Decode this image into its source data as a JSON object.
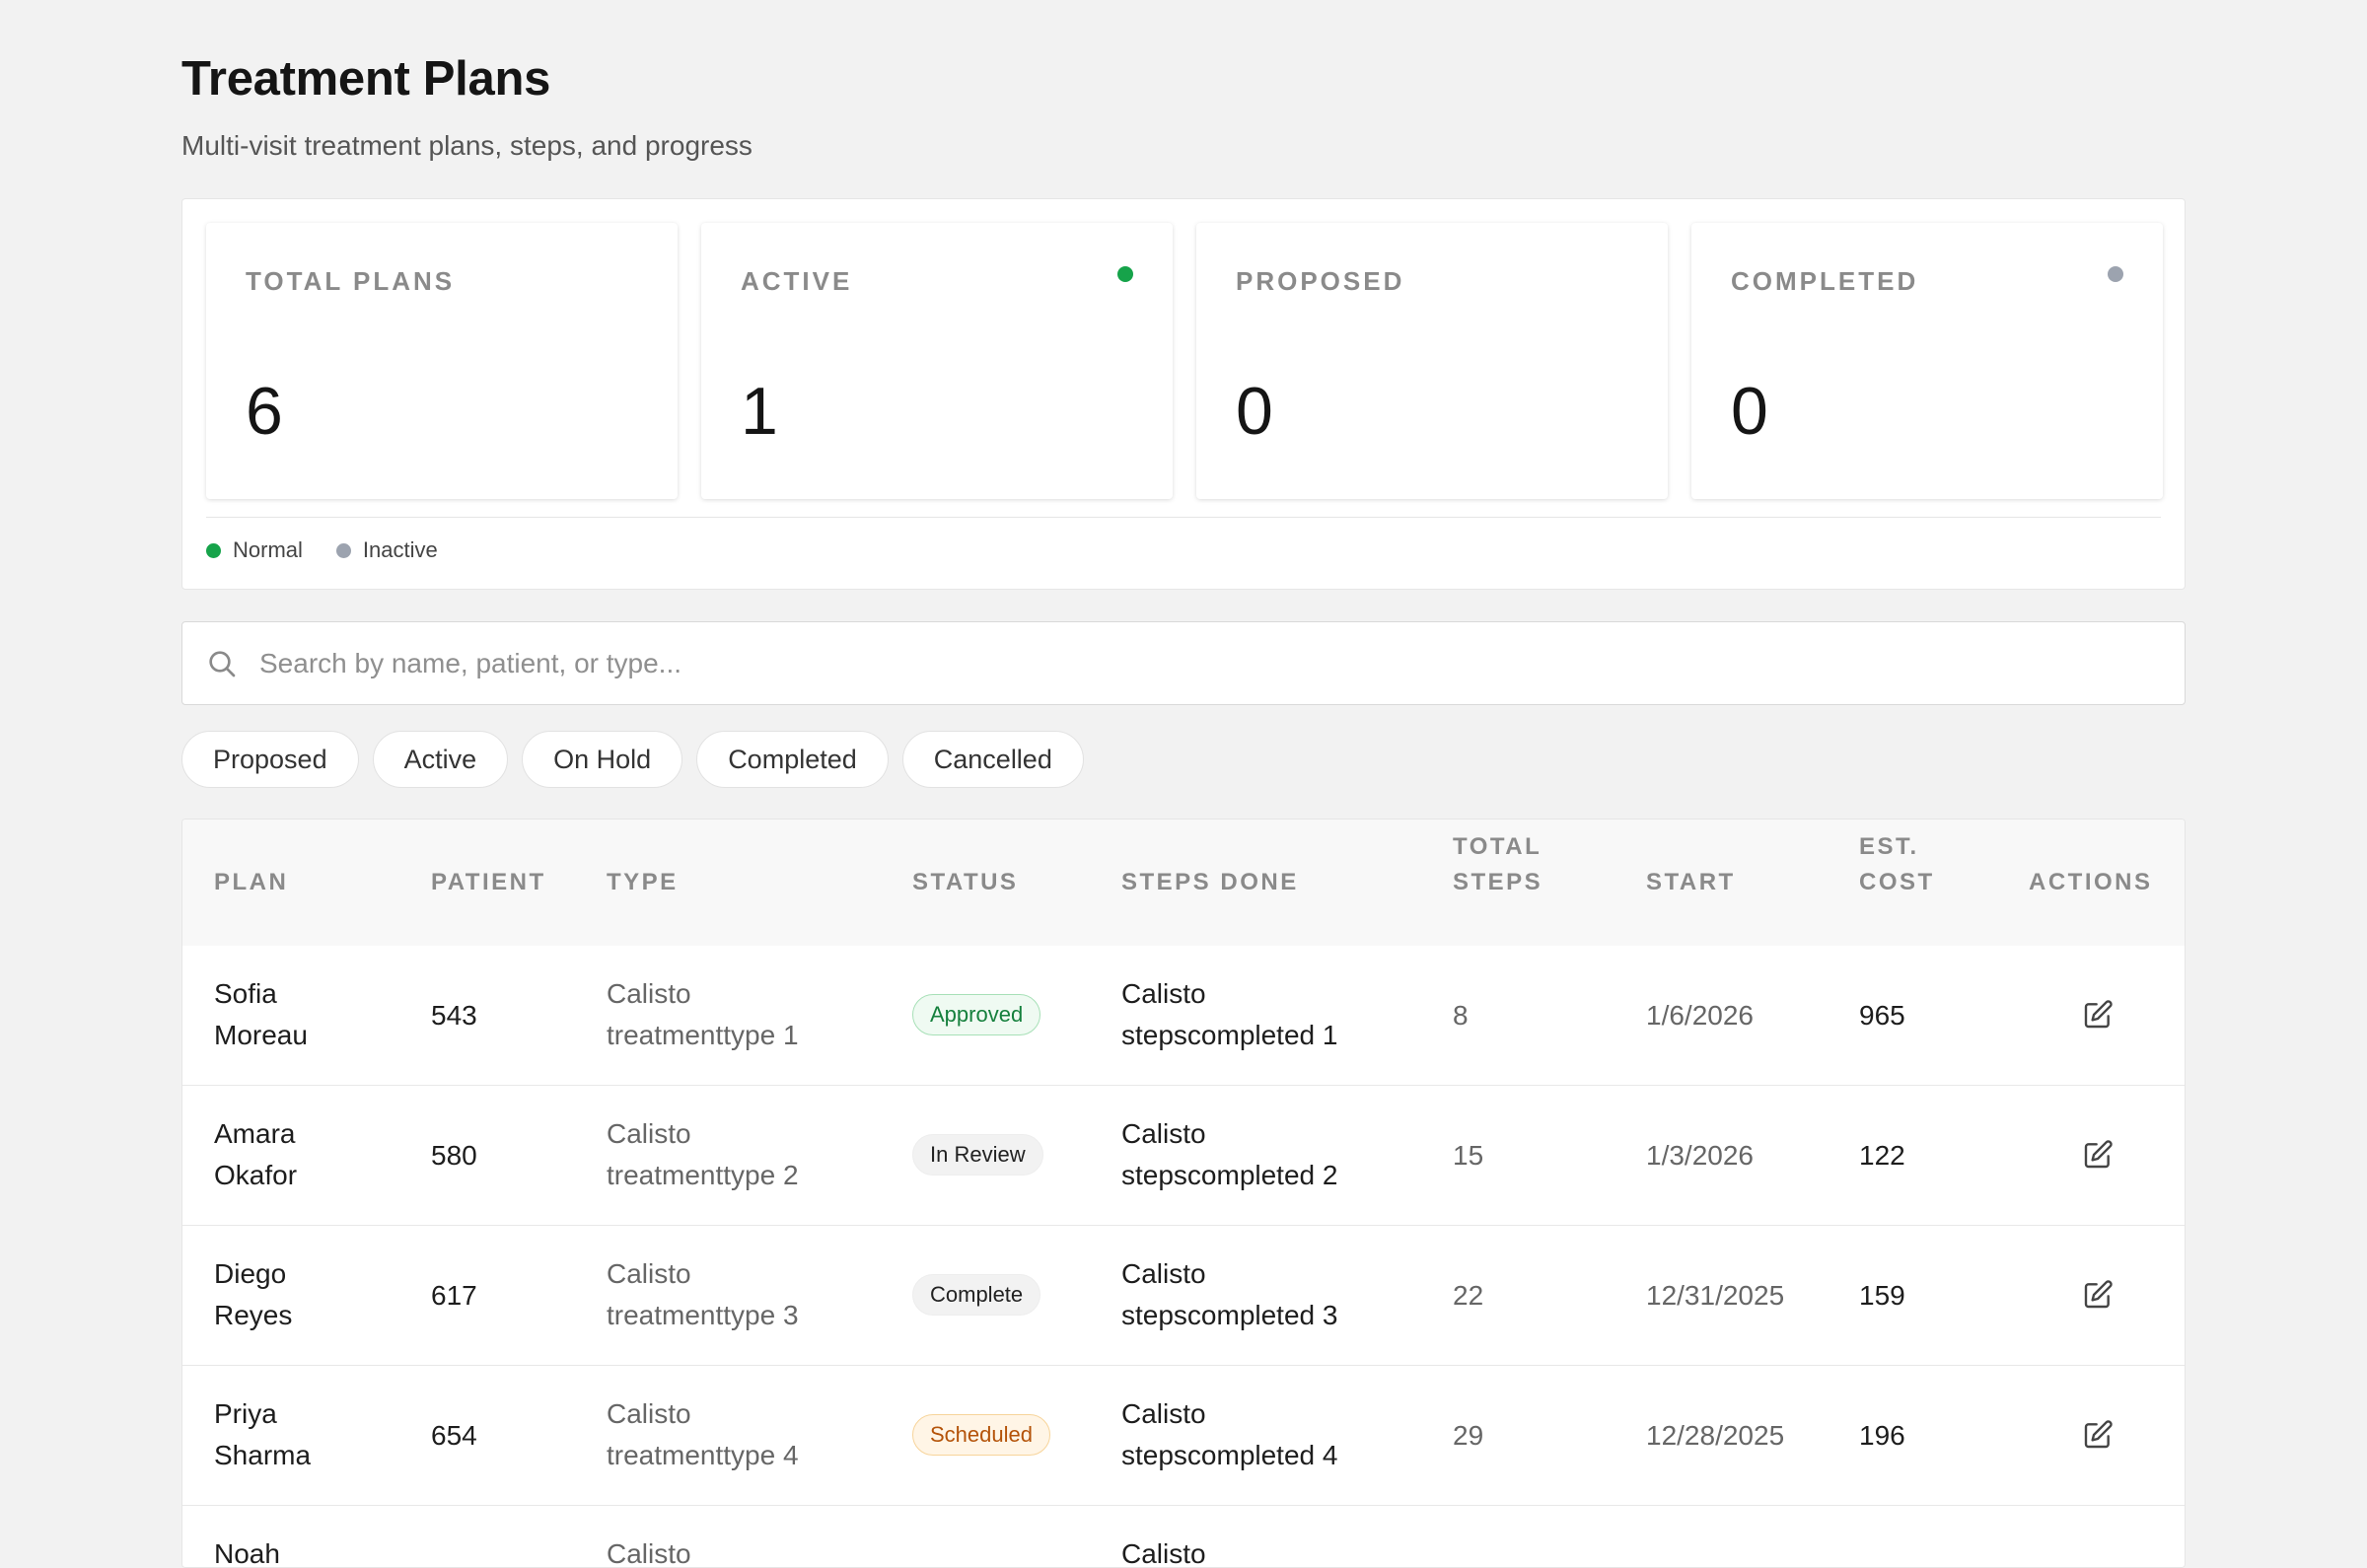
{
  "header": {
    "title": "Treatment Plans",
    "subtitle": "Multi-visit treatment plans, steps, and progress"
  },
  "stats": [
    {
      "label": "TOTAL PLANS",
      "value": "6",
      "indicator": null
    },
    {
      "label": "ACTIVE",
      "value": "1",
      "indicator": "#16a34a"
    },
    {
      "label": "PROPOSED",
      "value": "0",
      "indicator": null
    },
    {
      "label": "COMPLETED",
      "value": "0",
      "indicator": "#9ca3af"
    }
  ],
  "legend": [
    {
      "label": "Normal",
      "color": "#16a34a"
    },
    {
      "label": "Inactive",
      "color": "#9ca3af"
    }
  ],
  "search": {
    "placeholder": "Search by name, patient, or type...",
    "value": "",
    "icon": "search-icon"
  },
  "filters": [
    "Proposed",
    "Active",
    "On Hold",
    "Completed",
    "Cancelled"
  ],
  "table": {
    "columns": [
      "PLAN",
      "PATIENT",
      "TYPE",
      "STATUS",
      "STEPS DONE",
      "TOTAL STEPS",
      "START",
      "EST. COST",
      "ACTIONS"
    ],
    "rows": [
      {
        "plan": "Sofia Moreau",
        "patient": "543",
        "type": "Calisto treatmenttype 1",
        "status": "Approved",
        "steps_done": "Calisto stepscompleted 1",
        "total_steps": "8",
        "start": "1/6/2026",
        "est_cost": "965"
      },
      {
        "plan": "Amara Okafor",
        "patient": "580",
        "type": "Calisto treatmenttype 2",
        "status": "In Review",
        "steps_done": "Calisto stepscompleted 2",
        "total_steps": "15",
        "start": "1/3/2026",
        "est_cost": "122"
      },
      {
        "plan": "Diego Reyes",
        "patient": "617",
        "type": "Calisto treatmenttype 3",
        "status": "Complete",
        "steps_done": "Calisto stepscompleted 3",
        "total_steps": "22",
        "start": "12/31/2025",
        "est_cost": "159"
      },
      {
        "plan": "Priya Sharma",
        "patient": "654",
        "type": "Calisto treatmenttype 4",
        "status": "Scheduled",
        "steps_done": "Calisto stepscompleted 4",
        "total_steps": "29",
        "start": "12/28/2025",
        "est_cost": "196"
      },
      {
        "plan": "Noah",
        "patient": "",
        "type": "Calisto",
        "status": "",
        "steps_done": "Calisto",
        "total_steps": "",
        "start": "",
        "est_cost": ""
      }
    ],
    "action_icon": "edit-icon"
  }
}
